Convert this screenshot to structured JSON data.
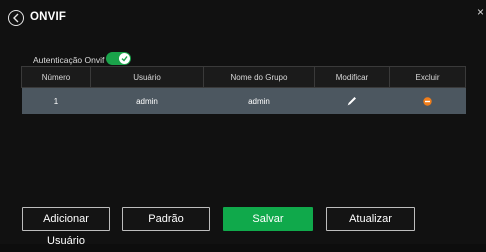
{
  "header": {
    "title": "ONVIF",
    "close_glyph": "×"
  },
  "auth": {
    "label": "Autenticação Onvif",
    "enabled": true
  },
  "table": {
    "columns": [
      "Número",
      "Usuário",
      "Nome do Grupo",
      "Modificar",
      "Excluir"
    ],
    "rows": [
      {
        "numero": "1",
        "usuario": "admin",
        "grupo": "admin"
      }
    ]
  },
  "buttons": {
    "add_user": "Adicionar Usuário",
    "default": "Padrão",
    "save": "Salvar",
    "refresh": "Atualizar"
  },
  "colors": {
    "accent_green": "#10a94b",
    "row_bg": "#4c5760",
    "delete_orange": "#f07d1a"
  },
  "icons": {
    "back": "back-circle-icon",
    "edit": "pencil-icon",
    "delete": "minus-circle-icon",
    "toggle": "check-icon"
  }
}
